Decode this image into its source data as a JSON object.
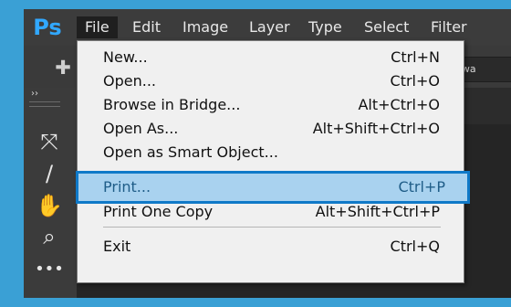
{
  "app": {
    "logo": "Ps"
  },
  "menubar": {
    "items": [
      {
        "label": "File"
      },
      {
        "label": "Edit"
      },
      {
        "label": "Image"
      },
      {
        "label": "Layer"
      },
      {
        "label": "Type"
      },
      {
        "label": "Select"
      },
      {
        "label": "Filter"
      }
    ]
  },
  "options_bar": {
    "field_value": "ent-Awa"
  },
  "toolbar": {
    "collapse": "››",
    "tools": [
      {
        "name": "move-tool",
        "icon": "⤧"
      },
      {
        "name": "line-tool",
        "icon": "/"
      },
      {
        "name": "hand-tool",
        "icon": "✋"
      },
      {
        "name": "zoom-tool",
        "icon": "⌕"
      },
      {
        "name": "more-tools",
        "icon": "•••"
      }
    ]
  },
  "file_menu": {
    "items": [
      {
        "label": "New...",
        "shortcut": "Ctrl+N"
      },
      {
        "label": "Open...",
        "shortcut": "Ctrl+O"
      },
      {
        "label": "Browse in Bridge...",
        "shortcut": "Alt+Ctrl+O"
      },
      {
        "label": "Open As...",
        "shortcut": "Alt+Shift+Ctrl+O"
      },
      {
        "label": "Open as Smart Object...",
        "shortcut": ""
      },
      {
        "label": "Print...",
        "shortcut": "Ctrl+P"
      },
      {
        "label": "Print One Copy",
        "shortcut": "Alt+Shift+Ctrl+P"
      },
      {
        "label": "Exit",
        "shortcut": "Ctrl+Q"
      }
    ]
  },
  "colors": {
    "frame_blue": "#3aa0d5",
    "highlight_fill": "#a9d2ef",
    "highlight_border": "#0f79c8"
  }
}
